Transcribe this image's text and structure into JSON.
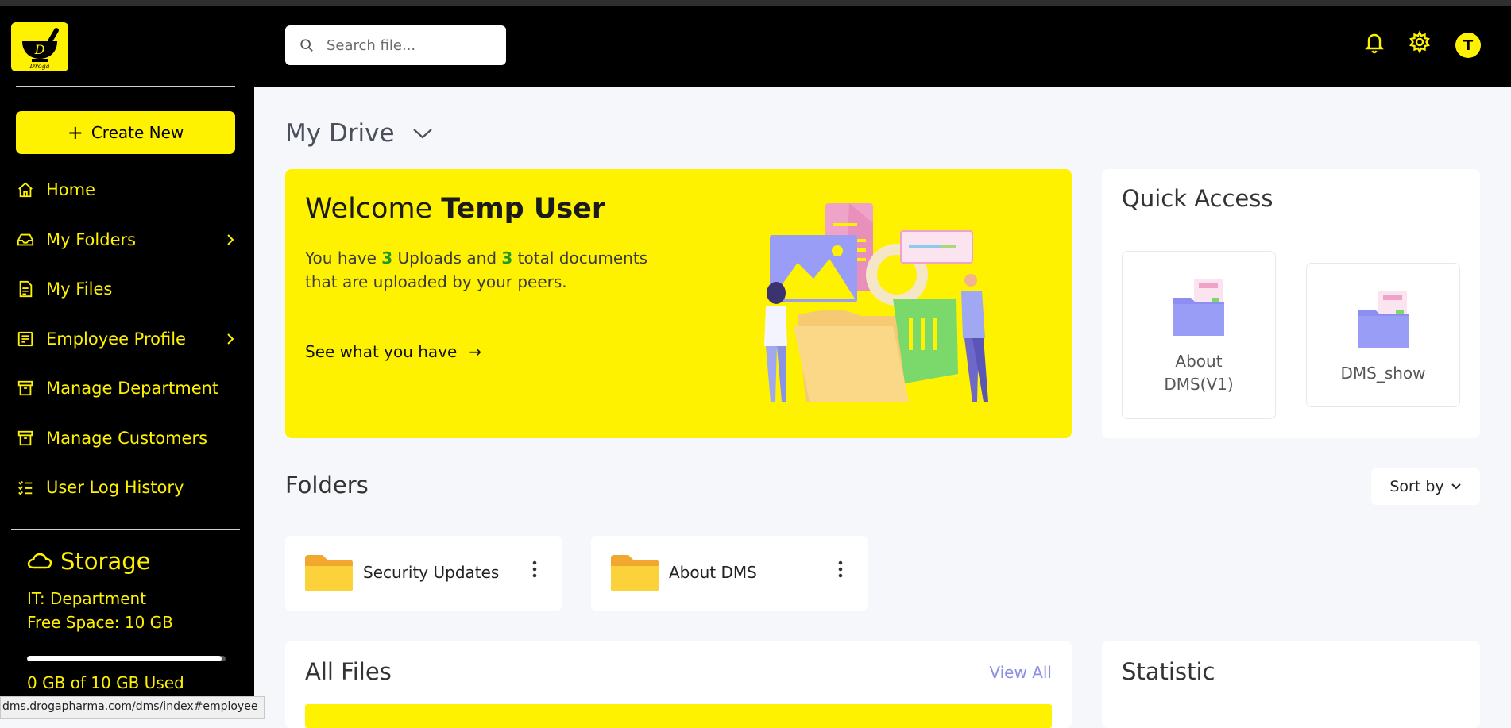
{
  "sidebar": {
    "logo_text": "Droga",
    "logo_letter": "D",
    "create_button": "Create New",
    "items": [
      {
        "label": "Home",
        "icon": "home-icon",
        "has_submenu": false
      },
      {
        "label": "My Folders",
        "icon": "inbox-icon",
        "has_submenu": true
      },
      {
        "label": "My Files",
        "icon": "file-icon",
        "has_submenu": false
      },
      {
        "label": "Employee Profile",
        "icon": "profile-icon",
        "has_submenu": true
      },
      {
        "label": "Manage Department",
        "icon": "archive-icon",
        "has_submenu": false
      },
      {
        "label": "Manage Customers",
        "icon": "archive-icon",
        "has_submenu": false
      },
      {
        "label": "User Log History",
        "icon": "list-check-icon",
        "has_submenu": false
      }
    ],
    "storage": {
      "title": "Storage",
      "department": "IT: Department",
      "free_space": "Free Space: 10 GB",
      "used_text": "0 GB of 10 GB Used",
      "used_fraction": 0.98
    }
  },
  "status_bar_url": "dms.drogapharma.com/dms/index#employee",
  "header": {
    "search_placeholder": "Search file...",
    "avatar_letter": "T",
    "accent": "#fff200"
  },
  "main": {
    "drive_title": "My Drive",
    "welcome": {
      "prefix": "Welcome ",
      "user": "Temp User",
      "text_1": "You have ",
      "uploads": "3",
      "text_2": " Uploads and ",
      "documents": "3",
      "text_3": " total documents that are uploaded by your peers.",
      "link": "See what you have"
    },
    "quick_access": {
      "title": "Quick Access",
      "items": [
        {
          "line1": "About",
          "line2": "DMS(V1)"
        },
        {
          "line1": "DMS_show",
          "line2": ""
        }
      ]
    },
    "folders": {
      "title": "Folders",
      "sort_label": "Sort by",
      "items": [
        {
          "name": "Security Updates"
        },
        {
          "name": "About DMS"
        }
      ]
    },
    "all_files": {
      "title": "All Files",
      "view_all": "View All"
    },
    "statistic": {
      "title": "Statistic"
    }
  }
}
